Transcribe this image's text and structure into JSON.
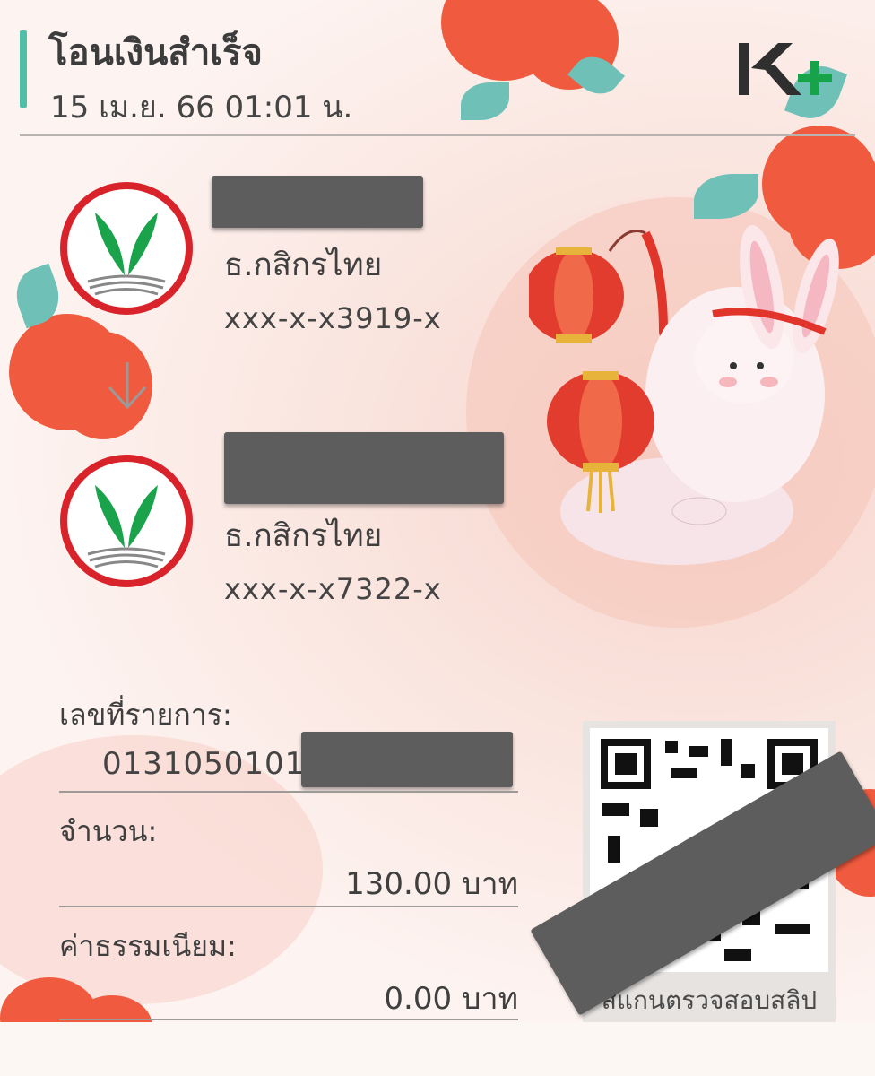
{
  "header": {
    "title": "โอนเงินสำเร็จ",
    "datetime": "15 เม.ย. 66  01:01 น."
  },
  "brand": {
    "logo_text": "K+",
    "k_color": "#2f2f2f",
    "plus_color": "#16a34a"
  },
  "sender": {
    "bank_name": "ธ.กสิกรไทย",
    "account": "xxx-x-x3919-x",
    "name_redacted": true
  },
  "receiver": {
    "bank_name": "ธ.กสิกรไทย",
    "account": "xxx-x-x7322-x",
    "name_redacted": true
  },
  "transaction": {
    "ref_label": "เลขที่รายการ:",
    "ref_value": "0131050101",
    "amount_label": "จำนวน:",
    "amount_value": "130.00 บาท",
    "fee_label": "ค่าธรรมเนียม:",
    "fee_value": "0.00 บาท"
  },
  "qr": {
    "caption": "สแกนตรวจสอบสลิป"
  },
  "icons": {
    "bank_logo": "kasikorn-logo-icon",
    "arrow": "arrow-down-icon",
    "qr": "qr-code-icon"
  },
  "colors": {
    "accent": "#4fbfa8",
    "kbank_green": "#1aa34a",
    "kbank_red": "#d8232a",
    "flower": "#f05a3e",
    "redaction": "#5d5d5d"
  }
}
